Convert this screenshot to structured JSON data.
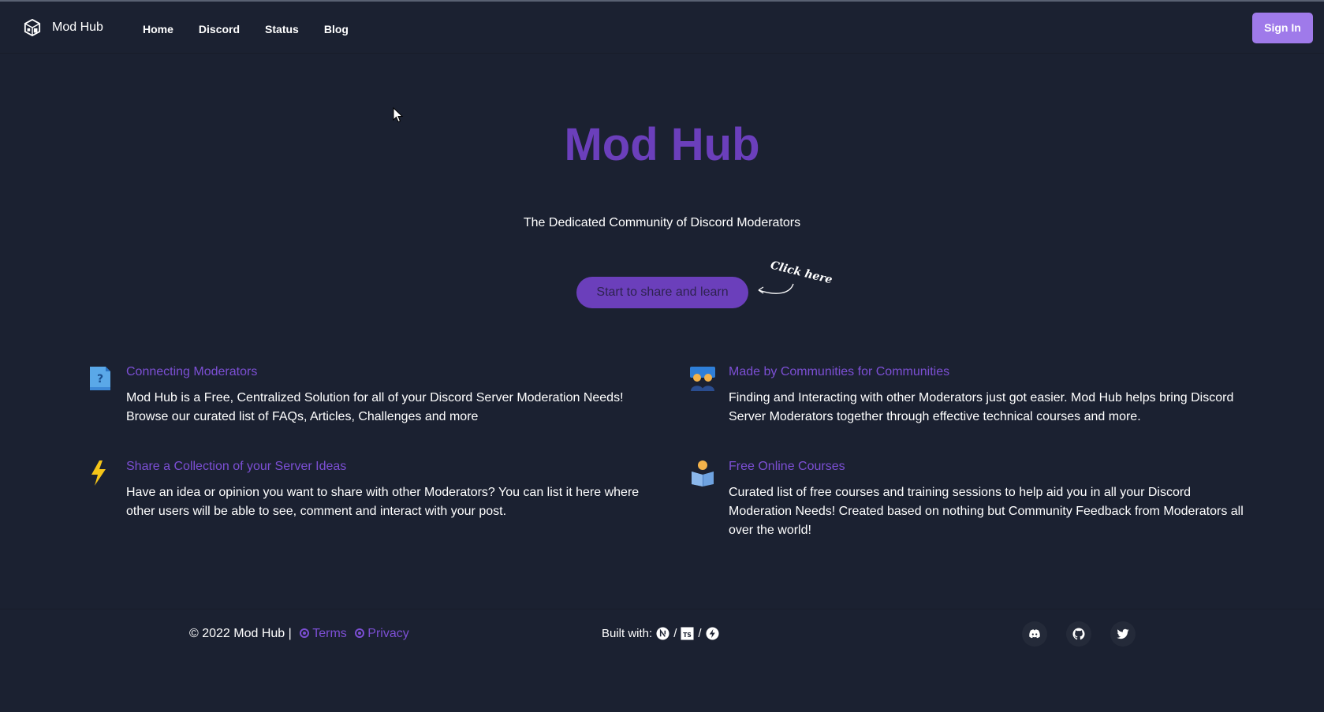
{
  "brand": {
    "name": "Mod Hub",
    "logo_icon": "cube-icon"
  },
  "nav": {
    "items": [
      "Home",
      "Discord",
      "Status",
      "Blog"
    ]
  },
  "header": {
    "signin_label": "Sign In"
  },
  "hero": {
    "title": "Mod Hub",
    "subtitle": "The Dedicated Community of Discord Moderators",
    "cta_label": "Start to share and learn",
    "hint": "Click here"
  },
  "features": [
    {
      "icon": "question-document-icon",
      "title": "Connecting Moderators",
      "desc_lines": [
        "Mod Hub is a Free, Centralized Solution for all of your Discord Server Moderation Needs!",
        "Browse our curated list of FAQs, Articles, Challenges and more"
      ]
    },
    {
      "icon": "community-people-icon",
      "title": "Made by Communities for Communities",
      "desc_lines": [
        "Finding and Interacting with other Moderators just got easier. Mod Hub helps bring Discord",
        "Server Moderators together through effective technical courses and more."
      ]
    },
    {
      "icon": "lightning-bolt-icon",
      "title": "Share a Collection of your Server Ideas",
      "desc_lines": [
        "Have an idea or opinion you want to share with other Moderators? You can list it here where",
        "other users will be able to see, comment and interact with your post."
      ]
    },
    {
      "icon": "reading-person-icon",
      "title": "Free Online Courses",
      "desc_lines": [
        "Curated list of free courses and training sessions to help aid you in all your Discord",
        "Moderation Needs! Created based on nothing but Community Feedback from Moderators all",
        "over the world!"
      ]
    }
  ],
  "footer": {
    "copyright": "© 2022 Mod Hub |",
    "terms_label": "Terms",
    "privacy_label": "Privacy",
    "built_with_label": "Built with:",
    "tech_icons": [
      "nextjs-icon",
      "typescript-icon",
      "lightning-icon"
    ],
    "tech_separator": "/",
    "social_icons": [
      "discord-icon",
      "github-icon",
      "twitter-icon"
    ]
  },
  "colors": {
    "background": "#1b2131",
    "accent": "#6b3fbb",
    "accent_light": "#9f7aea",
    "link": "#7c4fd4"
  }
}
